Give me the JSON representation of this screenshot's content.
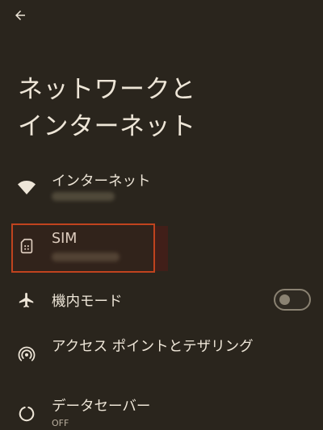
{
  "header": {
    "back_icon": "arrow-back-icon",
    "title_line1": "ネットワークと",
    "title_line2": "インターネット"
  },
  "items": [
    {
      "id": "internet",
      "label": "インターネット",
      "icon": "wifi-icon",
      "summary_redacted": true
    },
    {
      "id": "sim",
      "label": "SIM",
      "icon": "sim-card-icon",
      "summary_redacted": true,
      "highlighted": true
    },
    {
      "id": "airplane",
      "label": "機内モード",
      "icon": "airplane-icon",
      "toggle_on": false
    },
    {
      "id": "hotspot",
      "label": "アクセス ポイントとテザリング",
      "icon": "hotspot-icon"
    },
    {
      "id": "datasaver",
      "label": "データセーバー",
      "icon": "data-saver-icon",
      "summary": "OFF"
    }
  ],
  "colors": {
    "background": "#2a251d",
    "text": "#eee6d8",
    "highlight": "#c0431e"
  }
}
